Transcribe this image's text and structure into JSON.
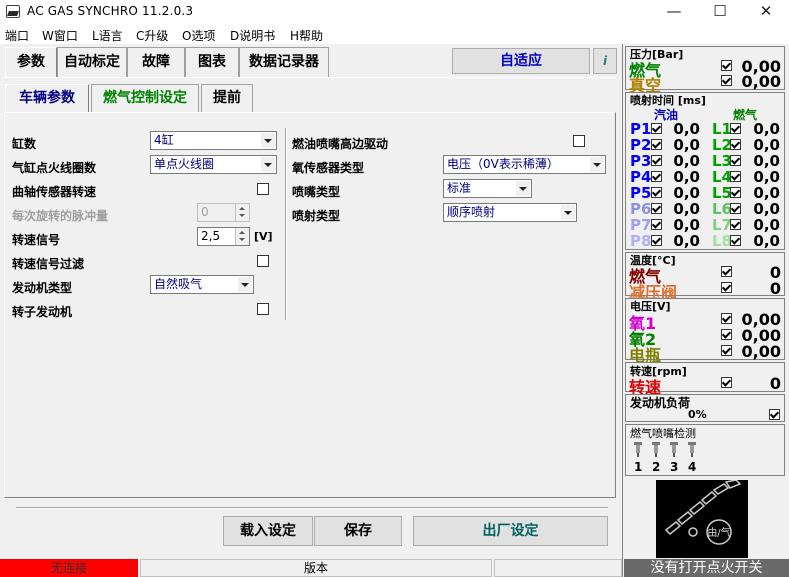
{
  "window": {
    "title": "AC GAS SYNCHRO  11.2.0.3",
    "minimize": "—",
    "maximize": "☐",
    "close": "✕"
  },
  "menu": [
    "端口",
    "W窗口",
    "L语言",
    "C升级",
    "O选项",
    "D说明书",
    "H帮助"
  ],
  "tabs": [
    "参数",
    "自动标定",
    "故障",
    "图表",
    "数据记录器"
  ],
  "adaptive_label": "自适应",
  "help_symbol": "i",
  "subtabs": [
    "车辆参数",
    "燃气控制设定",
    "提前"
  ],
  "subtab_colors": {
    "active": "#000080",
    "gas": "#008000",
    "other": "#000000"
  },
  "left_fields": {
    "cylinders": {
      "label": "缸数",
      "value": "4缸"
    },
    "coils": {
      "label": "气缸点火线圈数",
      "value": "单点火线圈"
    },
    "crank": {
      "label": "曲轴传感器转速"
    },
    "pulses": {
      "label": "每次旋转的脉冲量",
      "value": "0"
    },
    "rpm_signal": {
      "label": "转速信号",
      "value": "2,5",
      "unit": "[V]"
    },
    "rpm_filter": {
      "label": "转速信号过滤"
    },
    "engine_type": {
      "label": "发动机类型",
      "value": "自然吸气"
    },
    "rotary": {
      "label": "转子发动机"
    }
  },
  "right_fields": {
    "hi_side": {
      "label": "燃油喷嘴高边驱动"
    },
    "o2_type": {
      "label": "氧传感器类型",
      "value": "电压（0V表示稀薄）"
    },
    "injector_type": {
      "label": "喷嘴类型",
      "value": "标准"
    },
    "injection_type": {
      "label": "喷射类型",
      "value": "顺序喷射"
    }
  },
  "buttons": {
    "load": "载入设定",
    "save": "保存",
    "factory": "出厂设定"
  },
  "status": {
    "connection": "无连接",
    "version": "版本",
    "ignition": "没有打开点火开关"
  },
  "monitor": {
    "pressure": {
      "title": "压力[Bar]",
      "gas": "燃气",
      "vacuum": "真空",
      "gas_val": "0,00",
      "vac_val": "0,00"
    },
    "injection": {
      "title": "喷射时间 [ms]",
      "petrol": "汽油",
      "gas": "燃气",
      "rows": [
        {
          "p": "P1",
          "pv": "0,0",
          "l": "L1",
          "lv": "0,0"
        },
        {
          "p": "P2",
          "pv": "0,0",
          "l": "L2",
          "lv": "0,0"
        },
        {
          "p": "P3",
          "pv": "0,0",
          "l": "L3",
          "lv": "0,0"
        },
        {
          "p": "P4",
          "pv": "0,0",
          "l": "L4",
          "lv": "0,0"
        },
        {
          "p": "P5",
          "pv": "0,0",
          "l": "L5",
          "lv": "0,0"
        },
        {
          "p": "P6",
          "pv": "0,0",
          "l": "L6",
          "lv": "0,0"
        },
        {
          "p": "P7",
          "pv": "0,0",
          "l": "L7",
          "lv": "0,0"
        },
        {
          "p": "P8",
          "pv": "0,0",
          "l": "L8",
          "lv": "0,0"
        }
      ]
    },
    "temp": {
      "title": "温度[°C]",
      "gas": "燃气",
      "reducer": "减压阀",
      "gas_val": "0",
      "reducer_val": "0"
    },
    "voltage": {
      "title": "电压[V]",
      "o1": "氧1",
      "o2": "氧2",
      "battery": "电瓶",
      "o1_val": "0,00",
      "o2_val": "0,00",
      "bat_val": "0,00"
    },
    "rpm": {
      "title": "转速[rpm]",
      "label": "转速",
      "val": "0"
    },
    "load": {
      "title": "发动机负荷",
      "val": "0%"
    },
    "injector_test": {
      "title": "燃气喷嘴检测",
      "nums": [
        "1",
        "2",
        "3",
        "4"
      ]
    }
  }
}
